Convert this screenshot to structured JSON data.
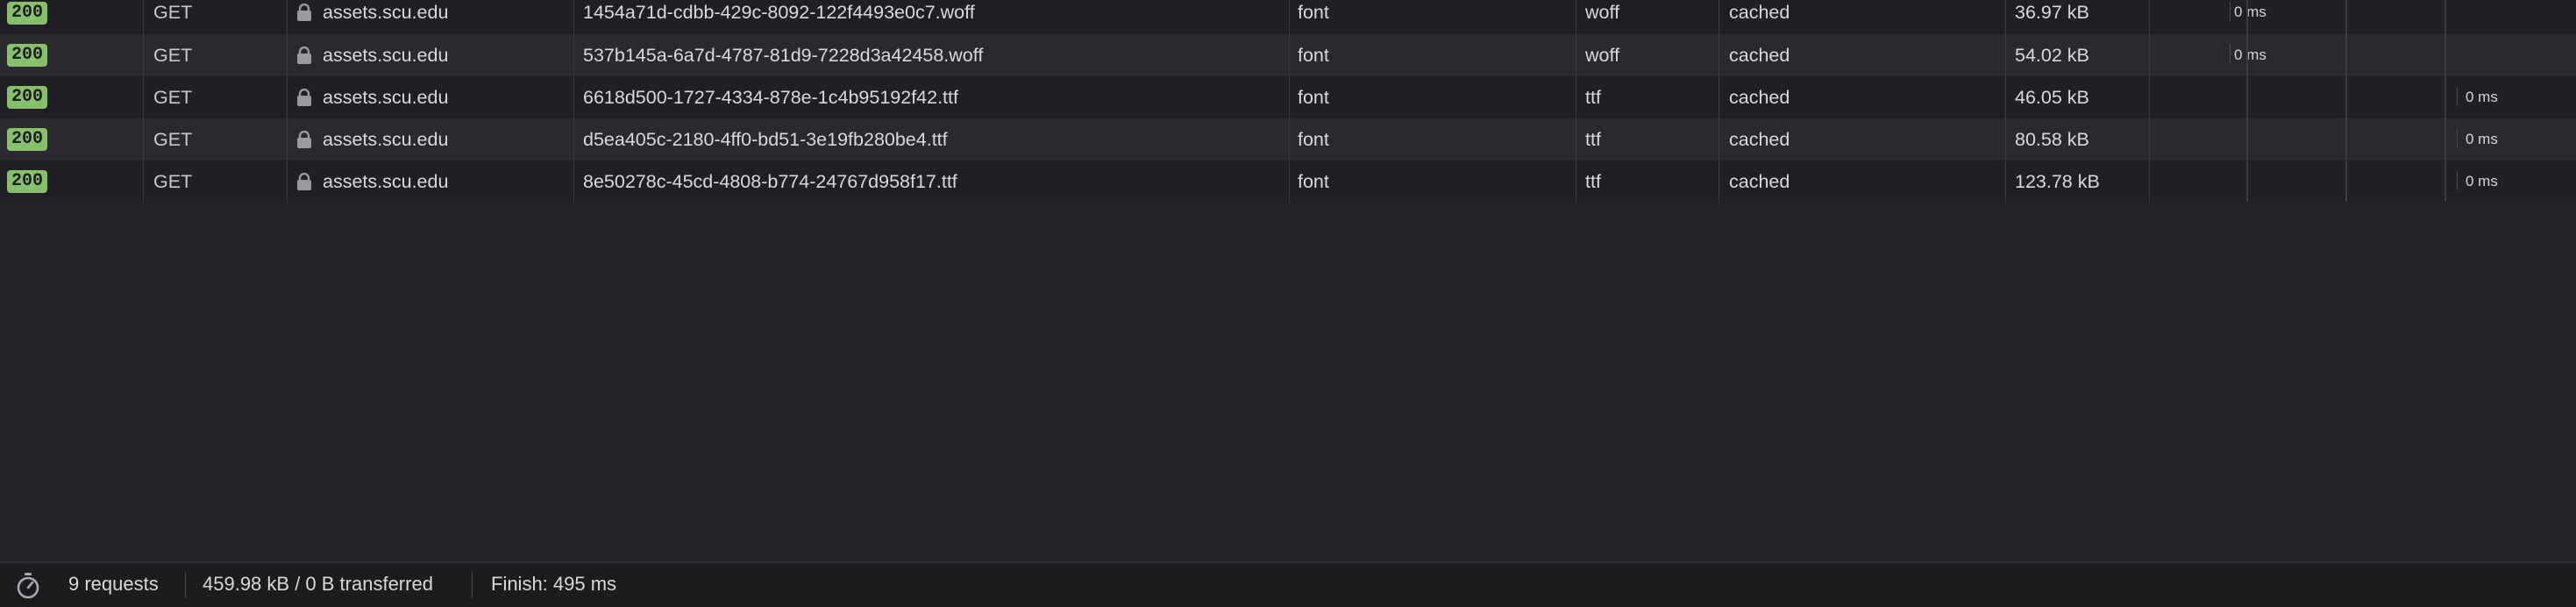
{
  "requests": [
    {
      "status": "200",
      "method": "GET",
      "domain": "assets.scu.edu",
      "file": "1454a71d-cdbb-429c-8092-122f4493e0c7.woff",
      "type": "font",
      "ext": "woff",
      "transferred": "cached",
      "size": "36.97 kB",
      "time": "0 ms"
    },
    {
      "status": "200",
      "method": "GET",
      "domain": "assets.scu.edu",
      "file": "537b145a-6a7d-4787-81d9-7228d3a42458.woff",
      "type": "font",
      "ext": "woff",
      "transferred": "cached",
      "size": "54.02 kB",
      "time": "0 ms"
    },
    {
      "status": "200",
      "method": "GET",
      "domain": "assets.scu.edu",
      "file": "6618d500-1727-4334-878e-1c4b95192f42.ttf",
      "type": "font",
      "ext": "ttf",
      "transferred": "cached",
      "size": "46.05 kB",
      "time": "0 ms"
    },
    {
      "status": "200",
      "method": "GET",
      "domain": "assets.scu.edu",
      "file": "d5ea405c-2180-4ff0-bd51-3e19fb280be4.ttf",
      "type": "font",
      "ext": "ttf",
      "transferred": "cached",
      "size": "80.58 kB",
      "time": "0 ms"
    },
    {
      "status": "200",
      "method": "GET",
      "domain": "assets.scu.edu",
      "file": "8e50278c-45cd-4808-b774-24767d958f17.ttf",
      "type": "font",
      "ext": "ttf",
      "transferred": "cached",
      "size": "123.78 kB",
      "time": "0 ms"
    }
  ],
  "status_bar": {
    "requests": "9 requests",
    "transferred": "459.98 kB / 0 B transferred",
    "finish": "Finish: 495 ms"
  },
  "icons": {
    "secure": "lock-icon",
    "timer": "stopwatch-icon"
  },
  "colors": {
    "status_ok": "#86c06b",
    "background": "#232327"
  }
}
